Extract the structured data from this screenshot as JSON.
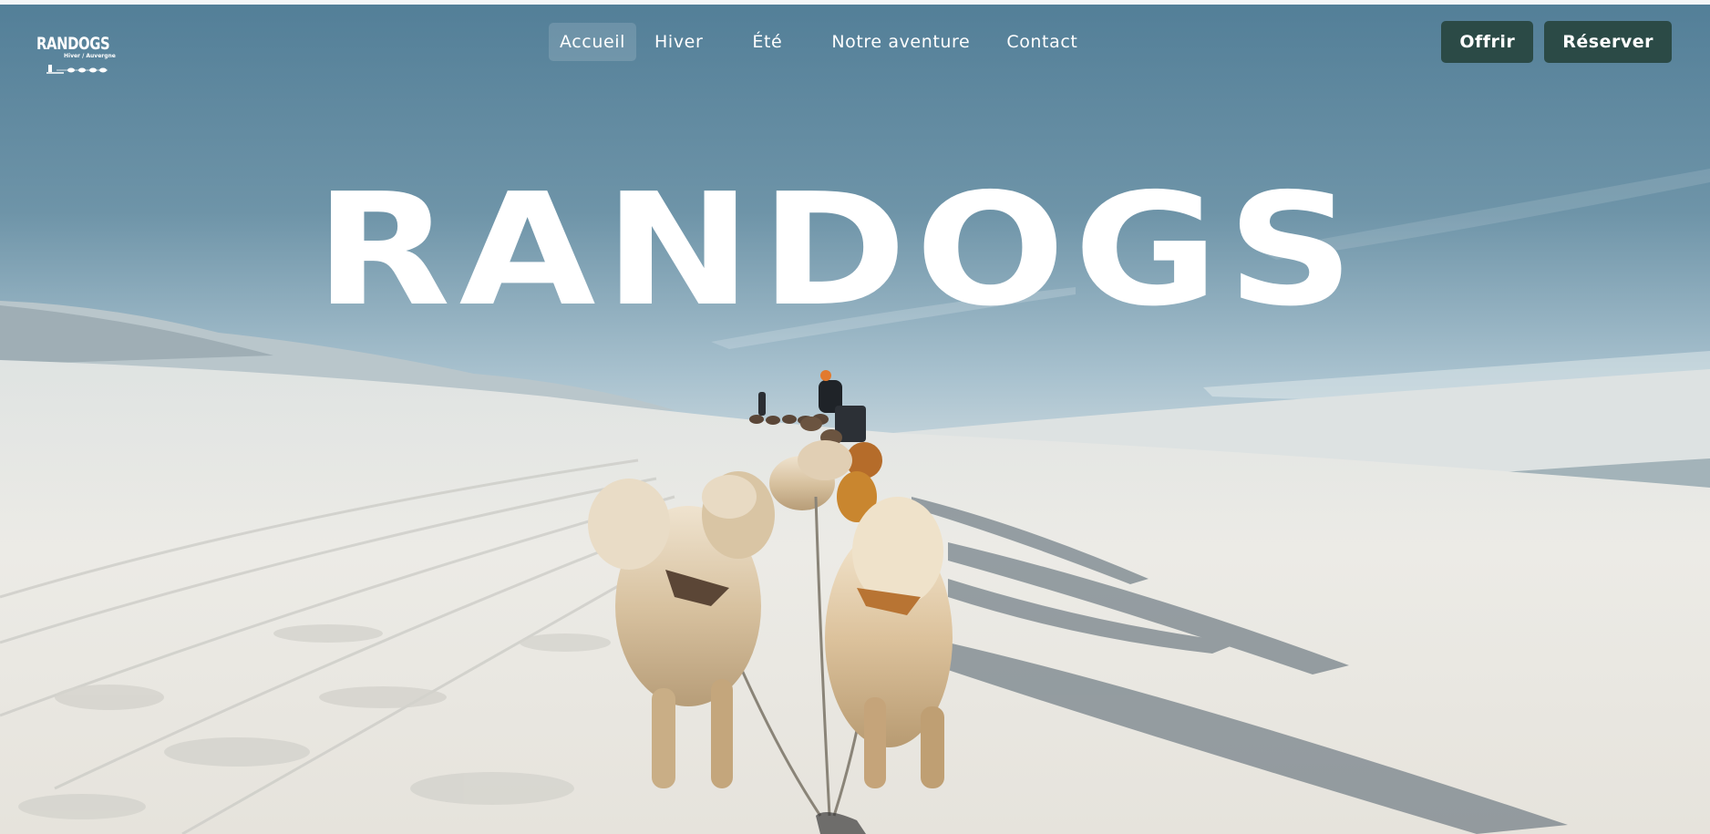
{
  "brand": {
    "logo_title": "RANDOGS",
    "logo_subtitle": "Hiver / Auvergne",
    "hero_title": "RANDOGS"
  },
  "nav": {
    "items": [
      {
        "label": "Accueil",
        "active": true
      },
      {
        "label": "Hiver",
        "active": false
      },
      {
        "label": "Été",
        "active": false
      },
      {
        "label": "Notre aventure",
        "active": false
      },
      {
        "label": "Contact",
        "active": false
      }
    ]
  },
  "actions": {
    "offer_label": "Offrir",
    "book_label": "Réserver"
  },
  "colors": {
    "button_bg": "#2b4a46",
    "sky_top": "#537f98",
    "sky_bottom": "#a9c2cf",
    "snow": "#eceae4",
    "dog_fur": "#d8c2a0"
  }
}
